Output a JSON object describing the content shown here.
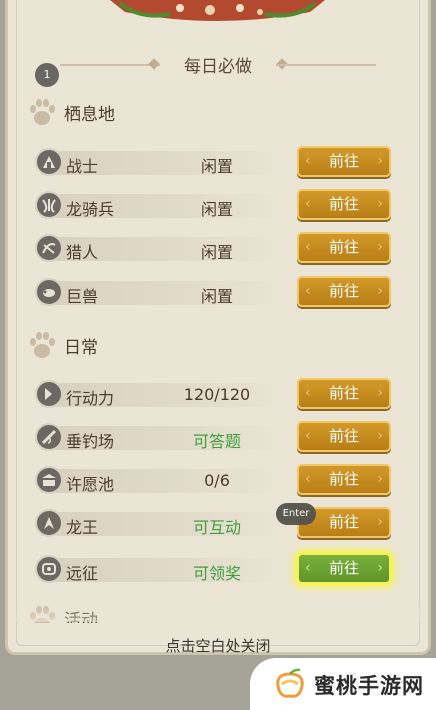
{
  "title": "每日必做",
  "badge": "1",
  "sections": [
    {
      "label": "栖息地",
      "rows": [
        {
          "name": "战士",
          "status": "闲置",
          "status_color": "normal",
          "icon": "warrior-icon"
        },
        {
          "name": "龙骑兵",
          "status": "闲置",
          "status_color": "normal",
          "icon": "dragoon-icon"
        },
        {
          "name": "猎人",
          "status": "闲置",
          "status_color": "normal",
          "icon": "hunter-icon"
        },
        {
          "name": "巨兽",
          "status": "闲置",
          "status_color": "normal",
          "icon": "behemoth-icon"
        }
      ]
    },
    {
      "label": "日常",
      "rows": [
        {
          "name": "行动力",
          "status": "120/120",
          "status_color": "normal",
          "icon": "stamina-icon"
        },
        {
          "name": "垂钓场",
          "status": "可答题",
          "status_color": "green",
          "icon": "fishing-icon"
        },
        {
          "name": "许愿池",
          "status": "0/6",
          "status_color": "normal",
          "icon": "wishing-well-icon"
        },
        {
          "name": "龙王",
          "status": "可互动",
          "status_color": "green",
          "icon": "dragon-king-icon"
        },
        {
          "name": "远征",
          "status": "可领奖",
          "status_color": "green",
          "icon": "expedition-icon"
        }
      ]
    },
    {
      "label": "活动"
    }
  ],
  "go_label": "前往",
  "tooltip": "Enter",
  "footer": "点击空白处关闭",
  "watermark": "蜜桃手游网",
  "colors": {
    "panel": "#ebe5d6",
    "button_gold": "#c68a20",
    "button_highlight": "#6aa431",
    "status_green": "#3f9f3a"
  }
}
